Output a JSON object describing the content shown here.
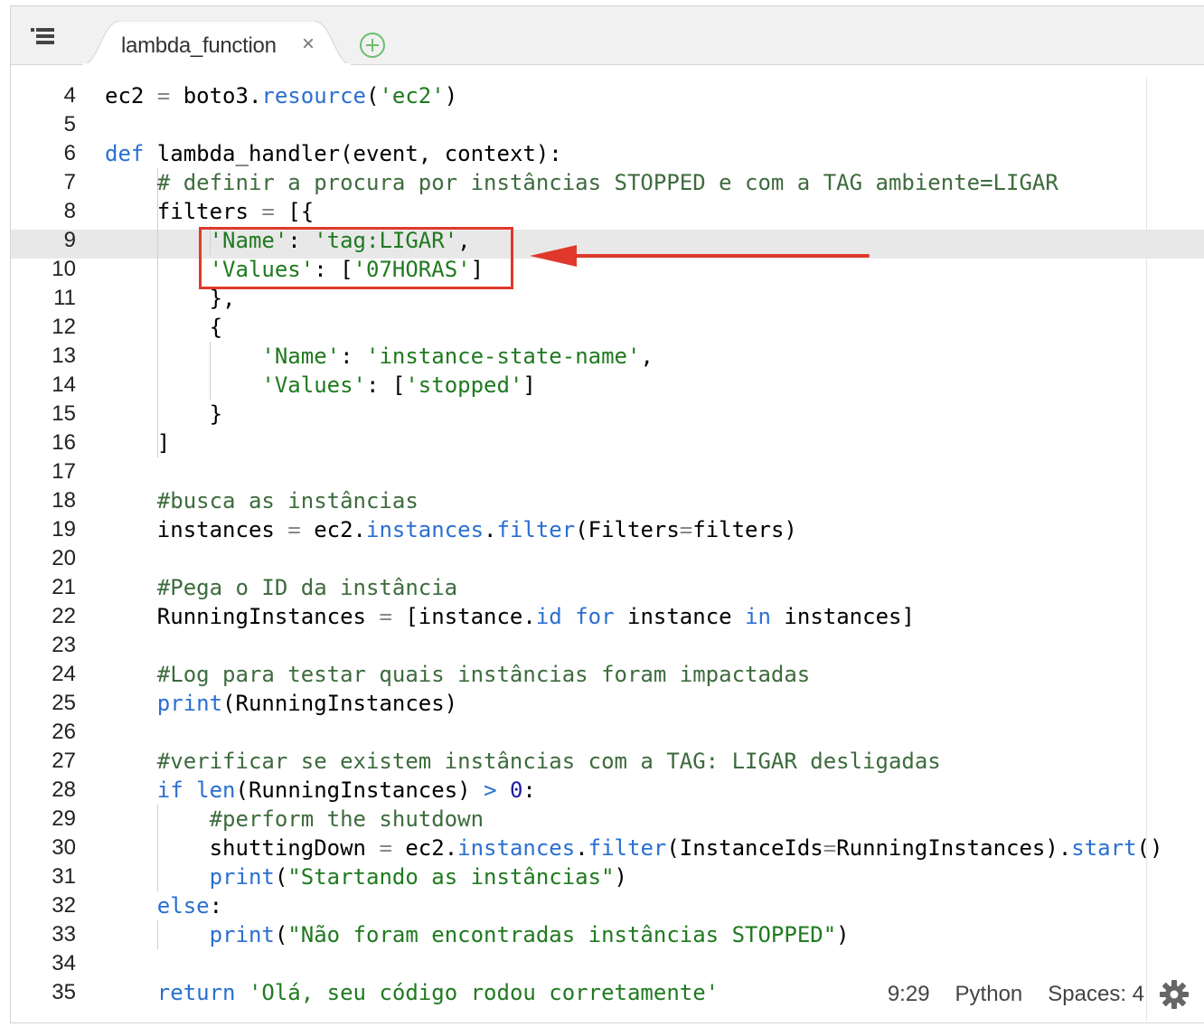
{
  "tab": {
    "label": "lambda_function",
    "close": "×"
  },
  "status": {
    "position": "9:29",
    "language": "Python",
    "indent": "Spaces: 4"
  },
  "code": {
    "lines": [
      {
        "n": "4",
        "text": "ec2 = boto3.resource('ec2')"
      },
      {
        "n": "5",
        "text": ""
      },
      {
        "n": "6",
        "text": "def lambda_handler(event, context):"
      },
      {
        "n": "7",
        "text": "    # definir a procura por instâncias STOPPED e com a TAG ambiente=LIGAR"
      },
      {
        "n": "8",
        "text": "    filters = [{"
      },
      {
        "n": "9",
        "text": "        'Name': 'tag:LIGAR',"
      },
      {
        "n": "10",
        "text": "        'Values': ['07HORAS']"
      },
      {
        "n": "11",
        "text": "        },"
      },
      {
        "n": "12",
        "text": "        {"
      },
      {
        "n": "13",
        "text": "            'Name': 'instance-state-name',"
      },
      {
        "n": "14",
        "text": "            'Values': ['stopped']"
      },
      {
        "n": "15",
        "text": "        }"
      },
      {
        "n": "16",
        "text": "    ]"
      },
      {
        "n": "17",
        "text": ""
      },
      {
        "n": "18",
        "text": "    #busca as instâncias"
      },
      {
        "n": "19",
        "text": "    instances = ec2.instances.filter(Filters=filters)"
      },
      {
        "n": "20",
        "text": ""
      },
      {
        "n": "21",
        "text": "    #Pega o ID da instância"
      },
      {
        "n": "22",
        "text": "    RunningInstances = [instance.id for instance in instances]"
      },
      {
        "n": "23",
        "text": ""
      },
      {
        "n": "24",
        "text": "    #Log para testar quais instâncias foram impactadas"
      },
      {
        "n": "25",
        "text": "    print(RunningInstances)"
      },
      {
        "n": "26",
        "text": ""
      },
      {
        "n": "27",
        "text": "    #verificar se existem instâncias com a TAG: LIGAR desligadas"
      },
      {
        "n": "28",
        "text": "    if len(RunningInstances) > 0:"
      },
      {
        "n": "29",
        "text": "        #perform the shutdown"
      },
      {
        "n": "30",
        "text": "        shuttingDown = ec2.instances.filter(InstanceIds=RunningInstances).start()"
      },
      {
        "n": "31",
        "text": "        print(\"Startando as instâncias\")"
      },
      {
        "n": "32",
        "text": "    else:"
      },
      {
        "n": "33",
        "text": "        print(\"Não foram encontradas instâncias STOPPED\")"
      },
      {
        "n": "34",
        "text": ""
      },
      {
        "n": "35",
        "text": "    return 'Olá, seu código rodou corretamente'"
      }
    ]
  },
  "colors": {
    "keyword": "#2a6fd1",
    "string": "#1f7a1f",
    "comment": "#3d6b3d",
    "highlight": "#e0392b"
  },
  "icons": {
    "menu": "file-list-icon",
    "add": "plus-circle-icon",
    "settings": "gear-icon",
    "annotation": "arrow-left-icon"
  }
}
